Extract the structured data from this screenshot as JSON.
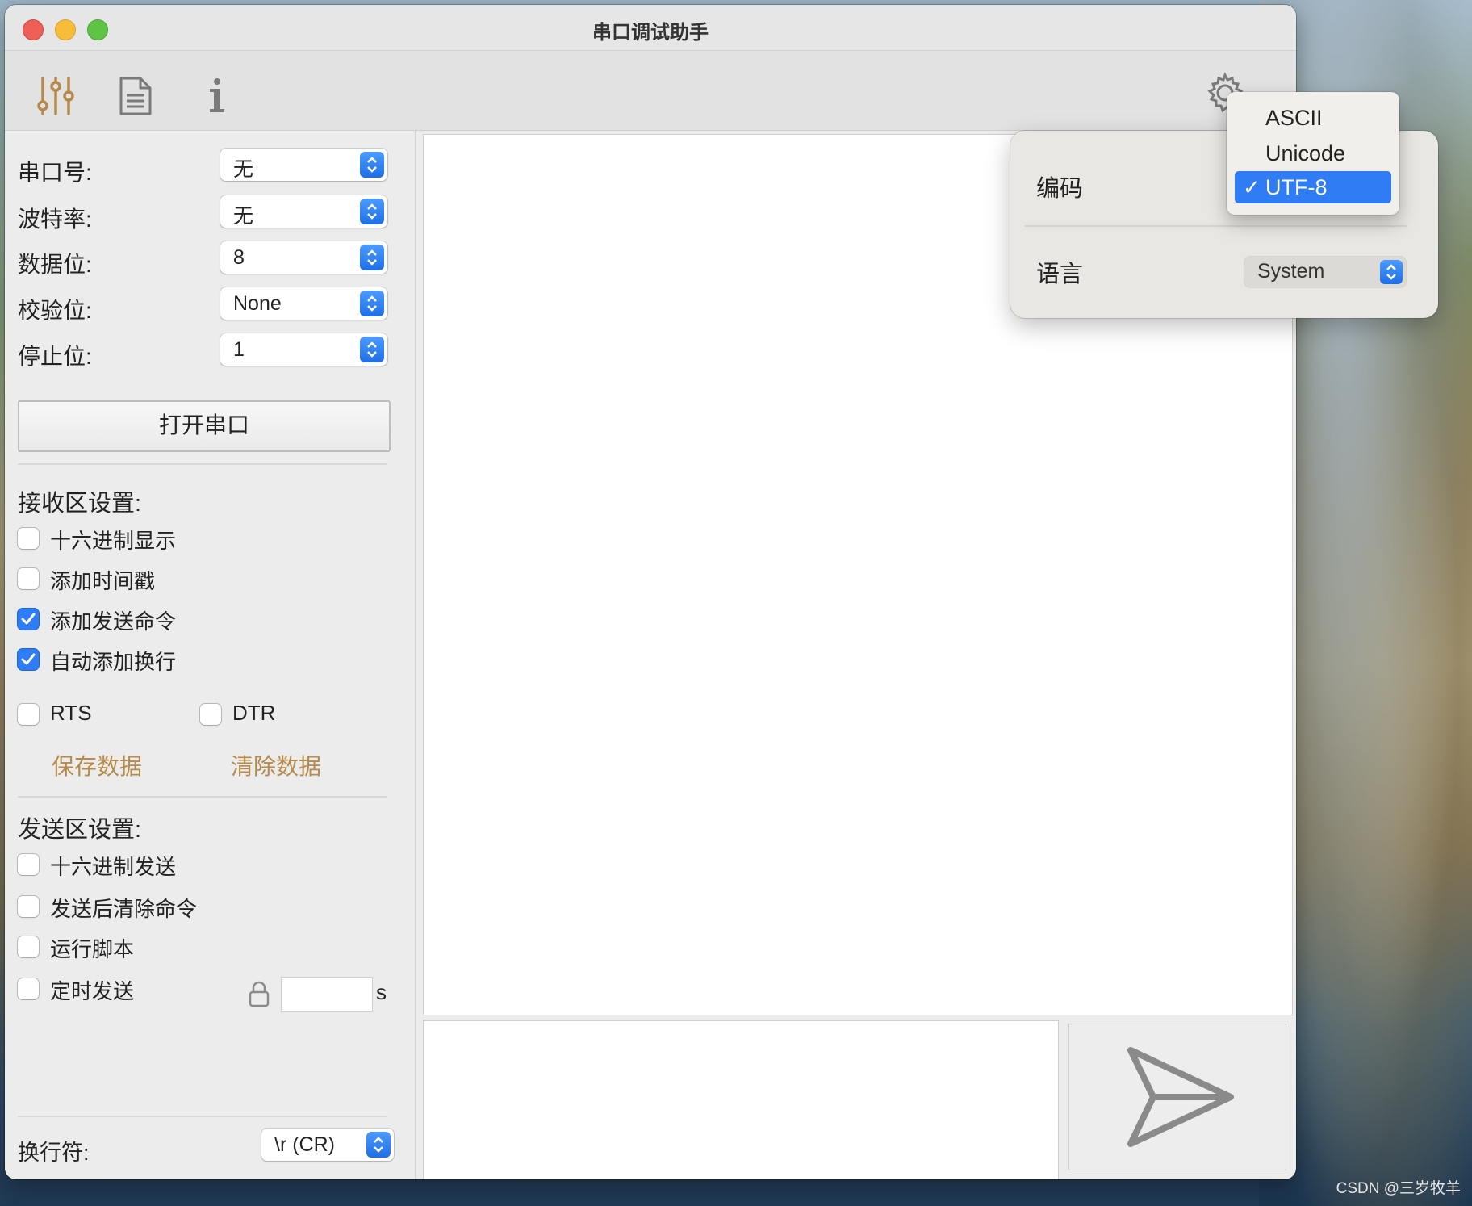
{
  "window": {
    "title": "串口调试助手"
  },
  "toolbar": {
    "icons": [
      "sliders-icon",
      "document-icon",
      "info-icon",
      "gear-icon"
    ],
    "accent_color": "#b58a4a"
  },
  "serial": {
    "port_label": "串口号:",
    "port_value": "无",
    "baud_label": "波特率:",
    "baud_value": "无",
    "databits_label": "数据位:",
    "databits_value": "8",
    "parity_label": "校验位:",
    "parity_value": "None",
    "stopbits_label": "停止位:",
    "stopbits_value": "1",
    "open_button": "打开串口"
  },
  "receive": {
    "section_title": "接收区设置:",
    "hex_display": {
      "label": "十六进制显示",
      "checked": false
    },
    "timestamp": {
      "label": "添加时间戳",
      "checked": false
    },
    "echo_command": {
      "label": "添加发送命令",
      "checked": true
    },
    "auto_newline": {
      "label": "自动添加换行",
      "checked": true
    },
    "rts": {
      "label": "RTS",
      "checked": false
    },
    "dtr": {
      "label": "DTR",
      "checked": false
    },
    "save_data": "保存数据",
    "clear_data": "清除数据"
  },
  "send": {
    "section_title": "发送区设置:",
    "hex_send": {
      "label": "十六进制发送",
      "checked": false
    },
    "clear_after_send": {
      "label": "发送后清除命令",
      "checked": false
    },
    "run_script": {
      "label": "运行脚本",
      "checked": false
    },
    "timed_send": {
      "label": "定时发送",
      "checked": false
    },
    "interval_value": "",
    "interval_unit": "s"
  },
  "footer": {
    "newline_label": "换行符:",
    "newline_value": "\\r  (CR)"
  },
  "settings_popover": {
    "encoding_label": "编码",
    "language_label": "语言",
    "language_value": "System",
    "encoding_options": [
      "ASCII",
      "Unicode",
      "UTF-8"
    ],
    "encoding_selected": "UTF-8",
    "check_mark": "✓"
  },
  "watermark": "CSDN @三岁牧羊"
}
